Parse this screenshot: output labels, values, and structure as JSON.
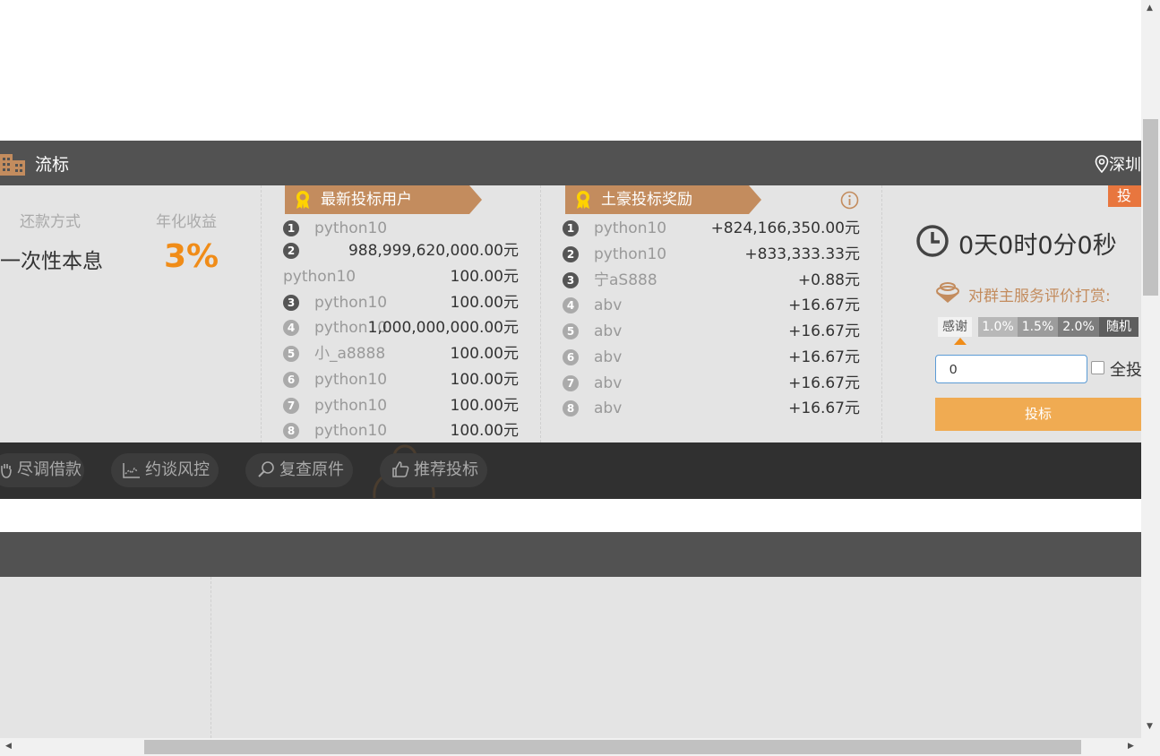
{
  "header": {
    "title": "流标",
    "location": "深圳"
  },
  "loan": {
    "repay_label": "还款方式",
    "repay_value": "一次性本息",
    "rate_label": "年化收益",
    "rate_value": "3%"
  },
  "latest": {
    "title": "最新投标用户",
    "rows": [
      {
        "rank": "1",
        "user": "python10",
        "amount": ""
      },
      {
        "rank": "2",
        "user": "",
        "amount": "988,999,620,000.00元"
      },
      {
        "rank": "",
        "user": "python10",
        "amount": "100.00元"
      },
      {
        "rank": "3",
        "user": "python10",
        "amount": "100.00元"
      },
      {
        "rank": "4",
        "user": "python10",
        "amount": "1,000,000,000.00元"
      },
      {
        "rank": "5",
        "user": "小_a8888",
        "amount": "100.00元"
      },
      {
        "rank": "6",
        "user": "python10",
        "amount": "100.00元"
      },
      {
        "rank": "7",
        "user": "python10",
        "amount": "100.00元"
      },
      {
        "rank": "8",
        "user": "python10",
        "amount": "100.00元"
      }
    ]
  },
  "tycoon": {
    "title": "土豪投标奖励",
    "rows": [
      {
        "rank": "1",
        "user": "python10",
        "amount": "+824,166,350.00元"
      },
      {
        "rank": "2",
        "user": "python10",
        "amount": "+833,333.33元"
      },
      {
        "rank": "3",
        "user": "宁aS888",
        "amount": "+0.88元"
      },
      {
        "rank": "4",
        "user": "abv",
        "amount": "+16.67元"
      },
      {
        "rank": "5",
        "user": "abv",
        "amount": "+16.67元"
      },
      {
        "rank": "6",
        "user": "abv",
        "amount": "+16.67元"
      },
      {
        "rank": "7",
        "user": "abv",
        "amount": "+16.67元"
      },
      {
        "rank": "8",
        "user": "abv",
        "amount": "+16.67元"
      }
    ]
  },
  "bid": {
    "tag": "投标",
    "countdown": "0天0时0分0秒",
    "reward_label": "对群主服务评价打赏:",
    "chips": [
      "感谢",
      "1.0%",
      "1.5%",
      "2.0%",
      "随机"
    ],
    "input_value": "0",
    "all_in_label": "全投",
    "button": "投标"
  },
  "toolbar": {
    "items": [
      "尽调借款",
      "约谈风控",
      "复查原件",
      "推荐投标"
    ]
  },
  "colors": {
    "header": "#525252",
    "accent": "#f08c18",
    "ribbon": "#c38c5e",
    "button": "#f0ab52"
  }
}
